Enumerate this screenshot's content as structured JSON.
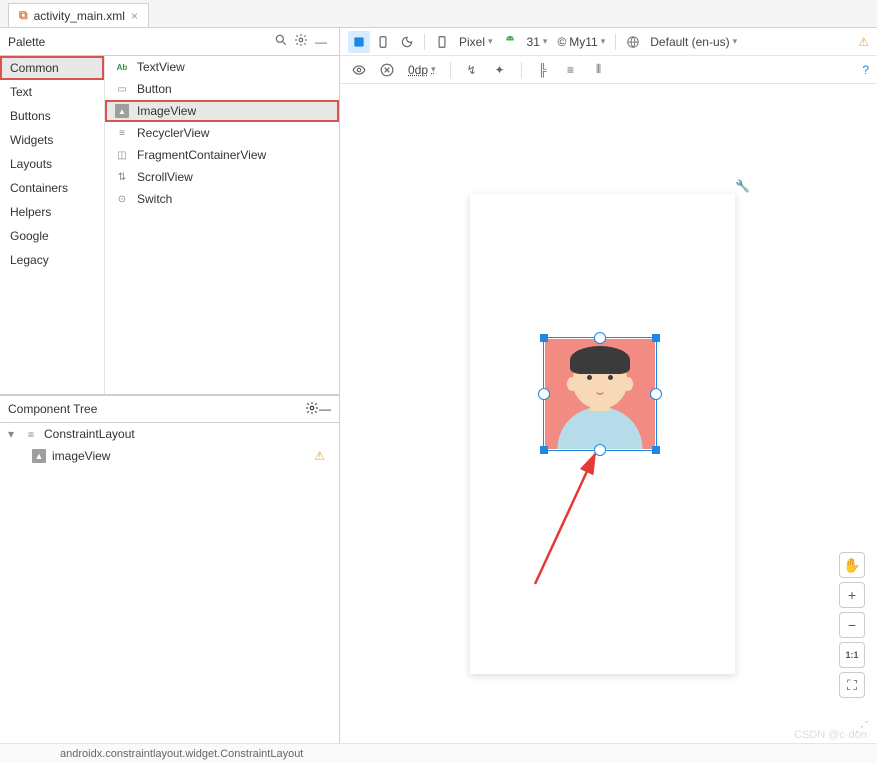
{
  "tab": {
    "filename": "activity_main.xml"
  },
  "palette": {
    "title": "Palette",
    "categories": [
      "Common",
      "Text",
      "Buttons",
      "Widgets",
      "Layouts",
      "Containers",
      "Helpers",
      "Google",
      "Legacy"
    ],
    "selected_category": "Common",
    "items": [
      {
        "label": "TextView",
        "icon": "Ab"
      },
      {
        "label": "Button",
        "icon": "btn"
      },
      {
        "label": "ImageView",
        "icon": "img"
      },
      {
        "label": "RecyclerView",
        "icon": "list"
      },
      {
        "label": "FragmentContainerView",
        "icon": "frag"
      },
      {
        "label": "ScrollView",
        "icon": "scroll"
      },
      {
        "label": "Switch",
        "icon": "switch"
      }
    ],
    "selected_item": "ImageView"
  },
  "tree": {
    "title": "Component Tree",
    "root": "ConstraintLayout",
    "child": "imageView"
  },
  "toolbar": {
    "device": "Pixel",
    "api": "31",
    "theme": "My11",
    "locale": "Default (en-us)",
    "margin": "0dp"
  },
  "status": {
    "path": "androidx.constraintlayout.widget.ConstraintLayout"
  },
  "zoom": {
    "ratio": "1:1"
  },
  "watermark": "CSDN @c·don"
}
